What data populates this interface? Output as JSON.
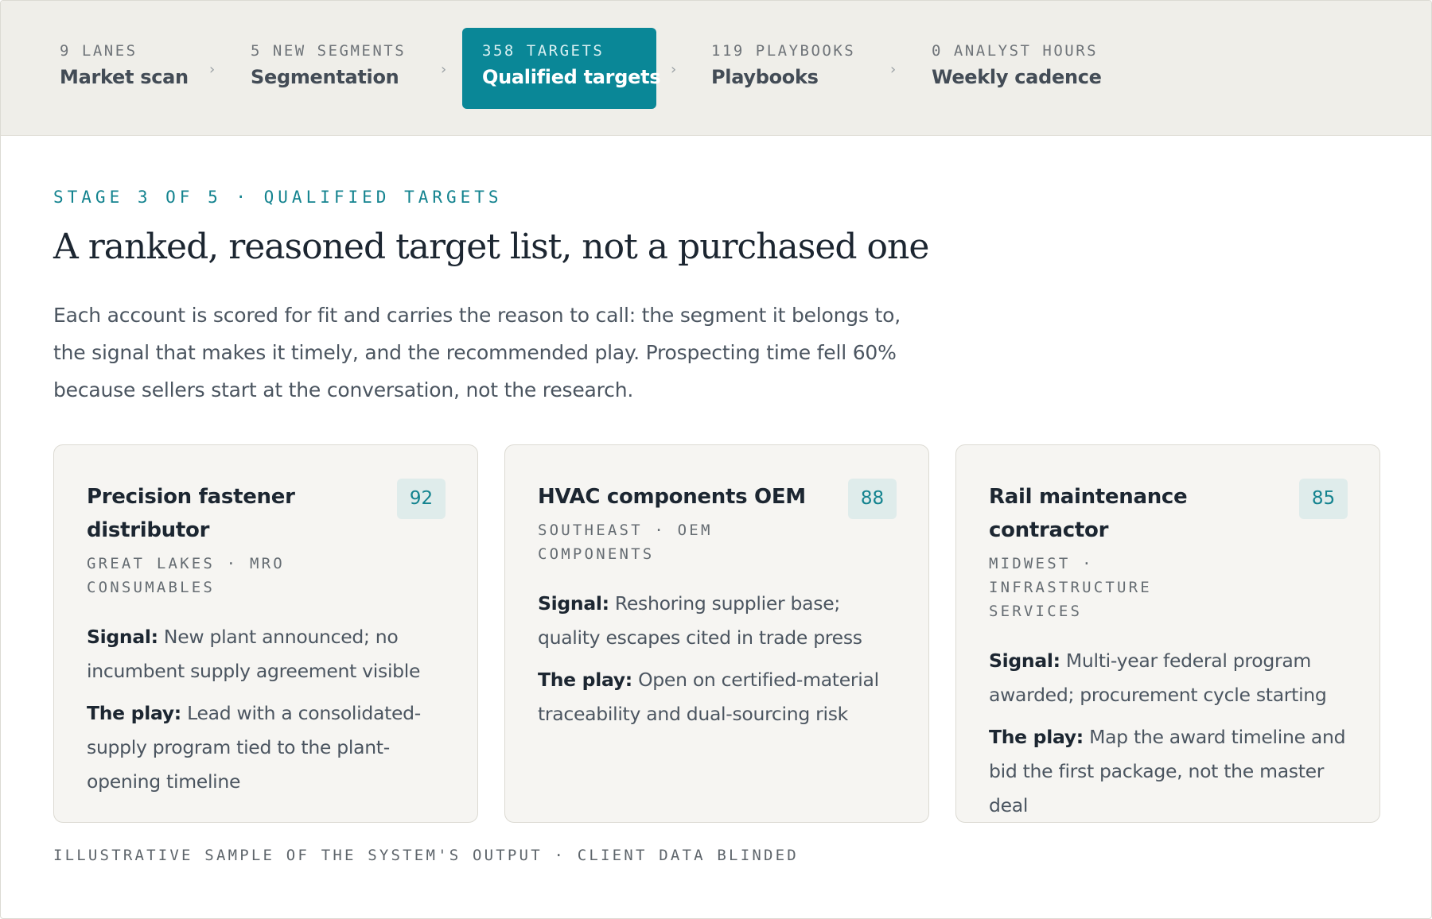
{
  "stages": [
    {
      "count": "9 LANES",
      "label": "Market scan",
      "active": false
    },
    {
      "count": "5 NEW SEGMENTS",
      "label": "Segmentation",
      "active": false
    },
    {
      "count": "358 TARGETS",
      "label": "Qualified targets",
      "active": true
    },
    {
      "count": "119 PLAYBOOKS",
      "label": "Playbooks",
      "active": false
    },
    {
      "count": "0 ANALYST HOURS",
      "label": "Weekly cadence",
      "active": false
    }
  ],
  "chevron": "›",
  "eyebrow": "STAGE 3 OF 5 · QUALIFIED TARGETS",
  "title": "A ranked, reasoned target list, not a purchased one",
  "description_lines": [
    "Each account is scored for fit and carries the reason to call: the segment it belongs to,",
    "the signal that makes it timely, and the recommended play. Prospecting time fell 60%",
    "because sellers start at the conversation, not the research."
  ],
  "labels": {
    "signal": "Signal:",
    "play": "The play:"
  },
  "cards": [
    {
      "name_lines": [
        "Precision fastener",
        "distributor"
      ],
      "score": "92",
      "meta_lines": [
        "GREAT LAKES · MRO",
        "CONSUMABLES"
      ],
      "signal_lines": [
        "New plant announced; no",
        "incumbent supply agreement visible"
      ],
      "play_lines": [
        "Lead with a consolidated-",
        "supply program tied to the plant-",
        "opening timeline"
      ]
    },
    {
      "name_lines": [
        "HVAC components OEM"
      ],
      "score": "88",
      "meta_lines": [
        "SOUTHEAST · OEM",
        "COMPONENTS"
      ],
      "signal_lines": [
        "Reshoring supplier base;",
        "quality escapes cited in trade press"
      ],
      "play_lines": [
        "Open on certified-material",
        "traceability and dual-sourcing risk"
      ]
    },
    {
      "name_lines": [
        "Rail maintenance contractor"
      ],
      "score": "85",
      "meta_lines": [
        "MIDWEST · INFRASTRUCTURE",
        "SERVICES"
      ],
      "signal_lines": [
        "Multi-year federal program",
        "awarded; procurement cycle starting"
      ],
      "play_lines": [
        "Map the award timeline and",
        "bid the first package, not the master",
        "deal"
      ]
    }
  ],
  "footnote": "ILLUSTRATIVE SAMPLE OF THE SYSTEM'S OUTPUT · CLIENT DATA BLINDED",
  "colors": {
    "accent": "#0a8797",
    "stage_bar": "#efeee9",
    "card_bg": "#f6f5f2",
    "badge_bg": "#dfeceb"
  }
}
